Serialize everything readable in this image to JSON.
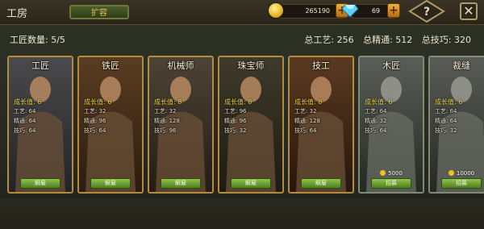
{
  "header": {
    "title": "工房",
    "expand_label": "扩容",
    "coins": "265190",
    "gems": "69"
  },
  "stats": {
    "craftsman_count": "工匠数量: 5/5",
    "total_craft": "总工艺: 256",
    "total_precision": "总精通: 512",
    "total_skill": "总技巧: 320"
  },
  "cards": [
    {
      "name": "工匠",
      "growth": "成长值: 6",
      "craft": "工艺: 64",
      "precision": "精通: 64",
      "skill": "技巧: 64",
      "button": "解雇",
      "price": ""
    },
    {
      "name": "铁匠",
      "growth": "成长值: 6",
      "craft": "工艺: 32",
      "precision": "精通: 96",
      "skill": "技巧: 64",
      "button": "解雇",
      "price": ""
    },
    {
      "name": "机械师",
      "growth": "成长值: 8",
      "craft": "工艺: 32",
      "precision": "精通: 128",
      "skill": "技巧: 96",
      "button": "解雇",
      "price": ""
    },
    {
      "name": "珠宝师",
      "growth": "成长值: 8",
      "craft": "工艺: 96",
      "precision": "精通: 96",
      "skill": "技巧: 32",
      "button": "解雇",
      "price": ""
    },
    {
      "name": "技工",
      "growth": "成长值: 8",
      "craft": "工艺: 32",
      "precision": "精通: 128",
      "skill": "技巧: 64",
      "button": "解雇",
      "price": ""
    },
    {
      "name": "木匠",
      "growth": "成长值: 6",
      "craft": "工艺: 64",
      "precision": "精通: 32",
      "skill": "技巧: 64",
      "button": "招募",
      "price": "5000"
    },
    {
      "name": "裁缝",
      "growth": "成长值: 6",
      "craft": "工艺: 64",
      "precision": "精通: 64",
      "skill": "技巧: 32",
      "button": "招募",
      "price": "10000"
    }
  ],
  "colors": {
    "accent_gold": "#e7cf3a",
    "hire_button": "#6fa33a",
    "card_border": "#b58a3a"
  }
}
